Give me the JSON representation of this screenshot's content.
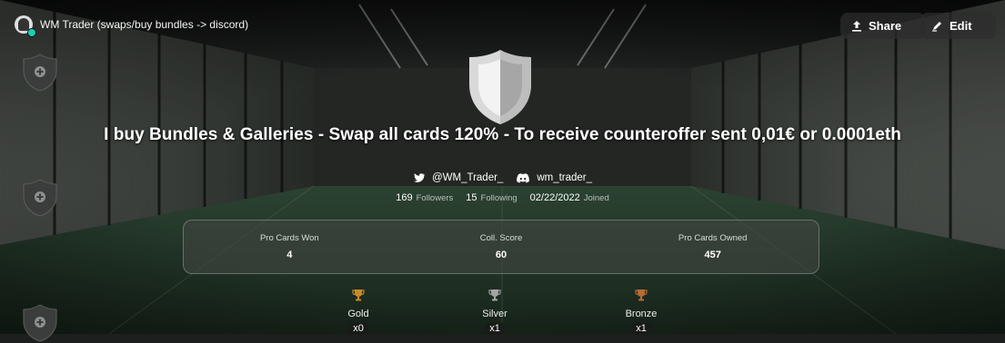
{
  "header": {
    "profile_name": "WM Trader (swaps/buy bundles -> discord)",
    "share_label": "Share",
    "edit_label": "Edit"
  },
  "headline": "I buy Bundles & Galleries - Swap all cards 120% - To receive counteroffer sent 0,01€ or 0.0001eth",
  "socials": {
    "twitter": "@WM_Trader_",
    "discord": "wm_trader_"
  },
  "stats": {
    "followers_count": "169",
    "followers_label": "Followers",
    "following_count": "15",
    "following_label": "Following",
    "joined_date": "02/22/2022",
    "joined_label": "Joined"
  },
  "panel": {
    "pro_cards_won_label": "Pro Cards Won",
    "pro_cards_won_value": "4",
    "coll_score_label": "Coll. Score",
    "coll_score_value": "60",
    "pro_cards_owned_label": "Pro Cards Owned",
    "pro_cards_owned_value": "457"
  },
  "trophies": [
    {
      "label": "Gold",
      "count": "x0",
      "color": "#c88a26"
    },
    {
      "label": "Silver",
      "count": "x1",
      "color": "#a3a3a3"
    },
    {
      "label": "Bronze",
      "count": "x1",
      "color": "#b56b34"
    }
  ],
  "icons": {
    "share": "share-icon",
    "edit": "edit-icon",
    "twitter": "twitter-icon",
    "discord": "discord-icon",
    "shield": "shield-icon",
    "trophy": "trophy-icon"
  },
  "colors": {
    "accent_dot": "#18d1b5",
    "panel_bg": "#404640"
  }
}
